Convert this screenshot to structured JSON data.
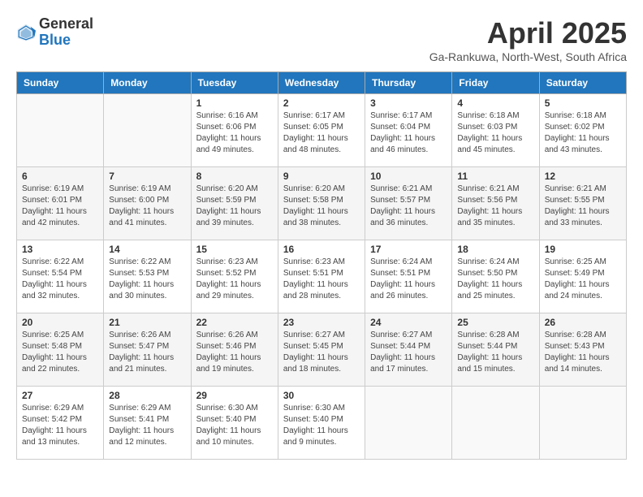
{
  "header": {
    "logo_general": "General",
    "logo_blue": "Blue",
    "title": "April 2025",
    "location": "Ga-Rankuwa, North-West, South Africa"
  },
  "columns": [
    "Sunday",
    "Monday",
    "Tuesday",
    "Wednesday",
    "Thursday",
    "Friday",
    "Saturday"
  ],
  "weeks": [
    [
      {
        "day": "",
        "info": ""
      },
      {
        "day": "",
        "info": ""
      },
      {
        "day": "1",
        "info": "Sunrise: 6:16 AM\nSunset: 6:06 PM\nDaylight: 11 hours and 49 minutes."
      },
      {
        "day": "2",
        "info": "Sunrise: 6:17 AM\nSunset: 6:05 PM\nDaylight: 11 hours and 48 minutes."
      },
      {
        "day": "3",
        "info": "Sunrise: 6:17 AM\nSunset: 6:04 PM\nDaylight: 11 hours and 46 minutes."
      },
      {
        "day": "4",
        "info": "Sunrise: 6:18 AM\nSunset: 6:03 PM\nDaylight: 11 hours and 45 minutes."
      },
      {
        "day": "5",
        "info": "Sunrise: 6:18 AM\nSunset: 6:02 PM\nDaylight: 11 hours and 43 minutes."
      }
    ],
    [
      {
        "day": "6",
        "info": "Sunrise: 6:19 AM\nSunset: 6:01 PM\nDaylight: 11 hours and 42 minutes."
      },
      {
        "day": "7",
        "info": "Sunrise: 6:19 AM\nSunset: 6:00 PM\nDaylight: 11 hours and 41 minutes."
      },
      {
        "day": "8",
        "info": "Sunrise: 6:20 AM\nSunset: 5:59 PM\nDaylight: 11 hours and 39 minutes."
      },
      {
        "day": "9",
        "info": "Sunrise: 6:20 AM\nSunset: 5:58 PM\nDaylight: 11 hours and 38 minutes."
      },
      {
        "day": "10",
        "info": "Sunrise: 6:21 AM\nSunset: 5:57 PM\nDaylight: 11 hours and 36 minutes."
      },
      {
        "day": "11",
        "info": "Sunrise: 6:21 AM\nSunset: 5:56 PM\nDaylight: 11 hours and 35 minutes."
      },
      {
        "day": "12",
        "info": "Sunrise: 6:21 AM\nSunset: 5:55 PM\nDaylight: 11 hours and 33 minutes."
      }
    ],
    [
      {
        "day": "13",
        "info": "Sunrise: 6:22 AM\nSunset: 5:54 PM\nDaylight: 11 hours and 32 minutes."
      },
      {
        "day": "14",
        "info": "Sunrise: 6:22 AM\nSunset: 5:53 PM\nDaylight: 11 hours and 30 minutes."
      },
      {
        "day": "15",
        "info": "Sunrise: 6:23 AM\nSunset: 5:52 PM\nDaylight: 11 hours and 29 minutes."
      },
      {
        "day": "16",
        "info": "Sunrise: 6:23 AM\nSunset: 5:51 PM\nDaylight: 11 hours and 28 minutes."
      },
      {
        "day": "17",
        "info": "Sunrise: 6:24 AM\nSunset: 5:51 PM\nDaylight: 11 hours and 26 minutes."
      },
      {
        "day": "18",
        "info": "Sunrise: 6:24 AM\nSunset: 5:50 PM\nDaylight: 11 hours and 25 minutes."
      },
      {
        "day": "19",
        "info": "Sunrise: 6:25 AM\nSunset: 5:49 PM\nDaylight: 11 hours and 24 minutes."
      }
    ],
    [
      {
        "day": "20",
        "info": "Sunrise: 6:25 AM\nSunset: 5:48 PM\nDaylight: 11 hours and 22 minutes."
      },
      {
        "day": "21",
        "info": "Sunrise: 6:26 AM\nSunset: 5:47 PM\nDaylight: 11 hours and 21 minutes."
      },
      {
        "day": "22",
        "info": "Sunrise: 6:26 AM\nSunset: 5:46 PM\nDaylight: 11 hours and 19 minutes."
      },
      {
        "day": "23",
        "info": "Sunrise: 6:27 AM\nSunset: 5:45 PM\nDaylight: 11 hours and 18 minutes."
      },
      {
        "day": "24",
        "info": "Sunrise: 6:27 AM\nSunset: 5:44 PM\nDaylight: 11 hours and 17 minutes."
      },
      {
        "day": "25",
        "info": "Sunrise: 6:28 AM\nSunset: 5:44 PM\nDaylight: 11 hours and 15 minutes."
      },
      {
        "day": "26",
        "info": "Sunrise: 6:28 AM\nSunset: 5:43 PM\nDaylight: 11 hours and 14 minutes."
      }
    ],
    [
      {
        "day": "27",
        "info": "Sunrise: 6:29 AM\nSunset: 5:42 PM\nDaylight: 11 hours and 13 minutes."
      },
      {
        "day": "28",
        "info": "Sunrise: 6:29 AM\nSunset: 5:41 PM\nDaylight: 11 hours and 12 minutes."
      },
      {
        "day": "29",
        "info": "Sunrise: 6:30 AM\nSunset: 5:40 PM\nDaylight: 11 hours and 10 minutes."
      },
      {
        "day": "30",
        "info": "Sunrise: 6:30 AM\nSunset: 5:40 PM\nDaylight: 11 hours and 9 minutes."
      },
      {
        "day": "",
        "info": ""
      },
      {
        "day": "",
        "info": ""
      },
      {
        "day": "",
        "info": ""
      }
    ]
  ]
}
